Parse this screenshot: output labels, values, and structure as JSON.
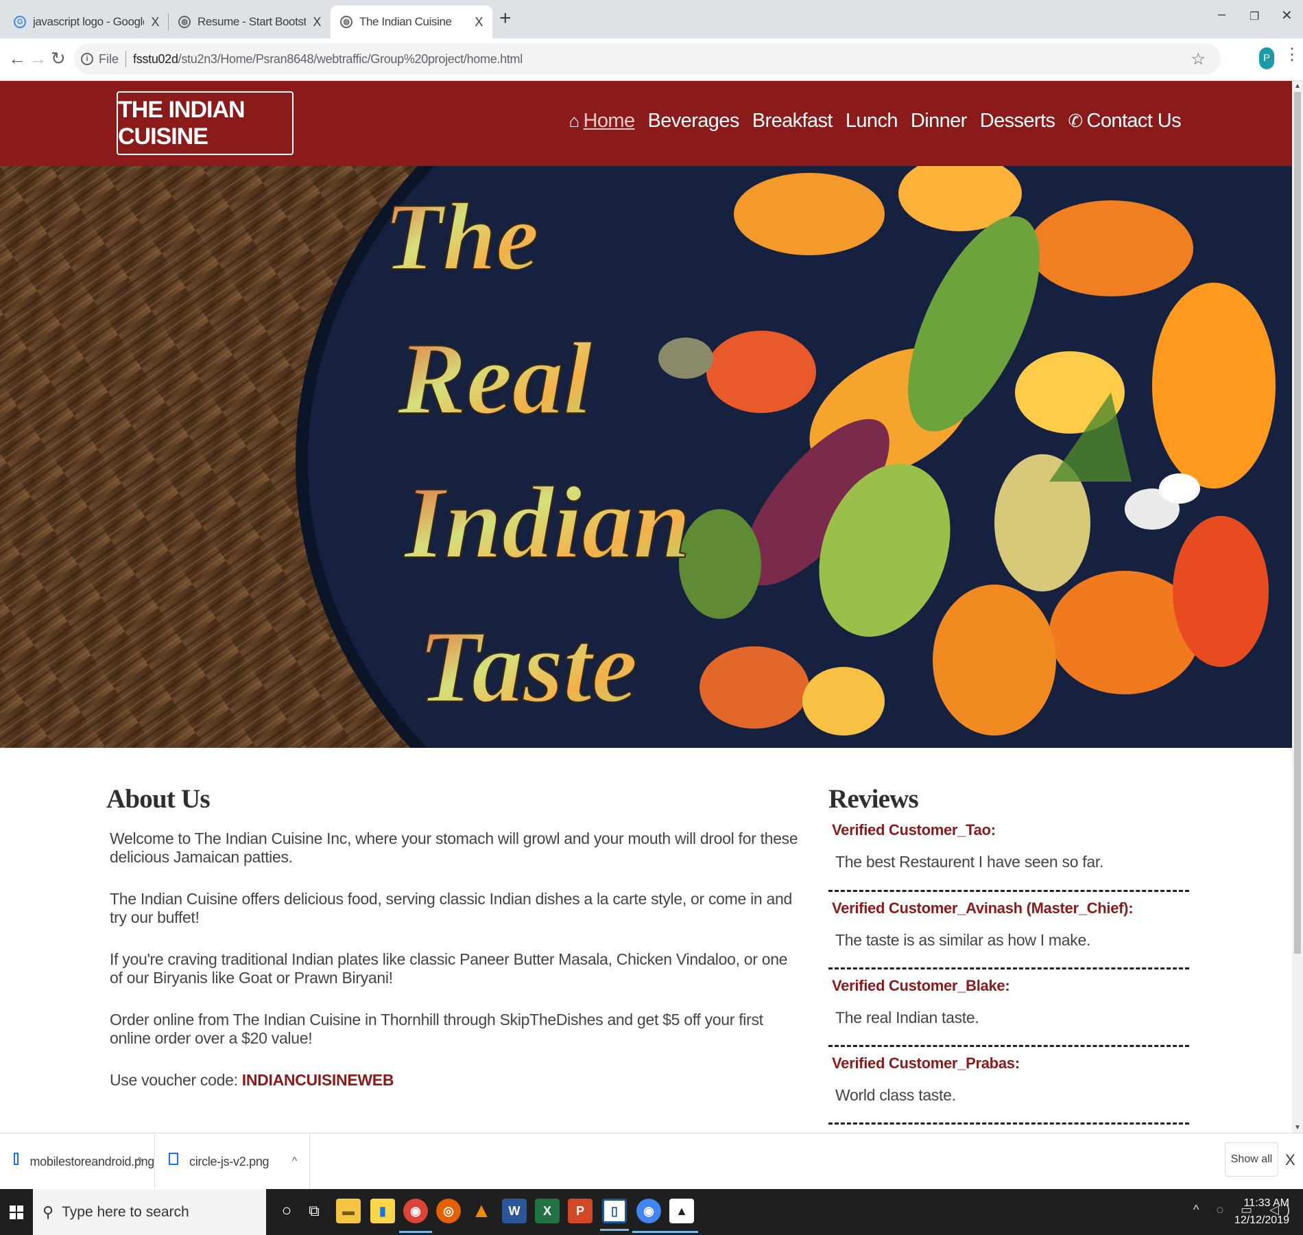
{
  "browser": {
    "tabs": [
      {
        "title": "javascript logo - Google Search",
        "icon": "google-icon",
        "active": false
      },
      {
        "title": "Resume - Start Bootstrap Theme",
        "icon": "globe-icon",
        "active": false
      },
      {
        "title": "The Indian Cuisine",
        "icon": "globe-icon",
        "active": true
      }
    ],
    "tab_close": "X",
    "new_tab": "+",
    "address": {
      "scheme_label": "File",
      "host": "fsstu02d",
      "path": "/stu2n3/Home/Psran8648/webtraffic/Group%20project/home.html"
    },
    "profile_initial": "P"
  },
  "site": {
    "brand": "THE INDIAN CUISINE",
    "nav": [
      {
        "label": "Home",
        "icon": "home-icon",
        "current": true
      },
      {
        "label": "Beverages"
      },
      {
        "label": "Breakfast"
      },
      {
        "label": "Lunch"
      },
      {
        "label": "Dinner"
      },
      {
        "label": "Desserts"
      },
      {
        "label": "Contact Us",
        "icon": "phone-icon"
      }
    ],
    "hero": {
      "lines": [
        "The",
        "Real",
        "Indian",
        "Taste"
      ]
    },
    "about": {
      "heading": "About Us",
      "paragraphs": [
        "Welcome to The Indian Cuisine Inc, where your stomach will growl and your mouth will drool for these delicious Jamaican patties.",
        "The Indian Cuisine offers delicious food, serving classic Indian dishes a la carte style, or come in and try our buffet!",
        "If you're craving traditional Indian plates like classic Paneer Butter Masala, Chicken Vindaloo, or one of our Biryanis like Goat or Prawn Biryani!",
        "Order online from The Indian Cuisine in Thornhill through SkipTheDishes and get $5 off your first online order over a $20 value!"
      ],
      "voucher_label": "Use voucher code:",
      "voucher_code": "INDIANCUISINEWEB"
    },
    "reviews": {
      "heading": "Reviews",
      "items": [
        {
          "name": "Verified Customer_Tao:",
          "text": "The best Restaurent I have seen so far."
        },
        {
          "name": "Verified Customer_Avinash (Master_Chief):",
          "text": "The taste is as similar as how I make."
        },
        {
          "name": "Verified Customer_Blake:",
          "text": "The real Indian taste."
        },
        {
          "name": "Verified Customer_Prabas:",
          "text": "World class taste."
        }
      ]
    }
  },
  "downloads": {
    "items": [
      "mobilestoreandroid.png",
      "circle-js-v2.png"
    ],
    "show_all": "Show all",
    "close": "X"
  },
  "taskbar": {
    "search_placeholder": "Type here to search",
    "time": "11:33 AM",
    "date": "12/12/2019"
  },
  "colors": {
    "brand_red": "#8b1a1a",
    "plate_navy": "#15213f"
  }
}
